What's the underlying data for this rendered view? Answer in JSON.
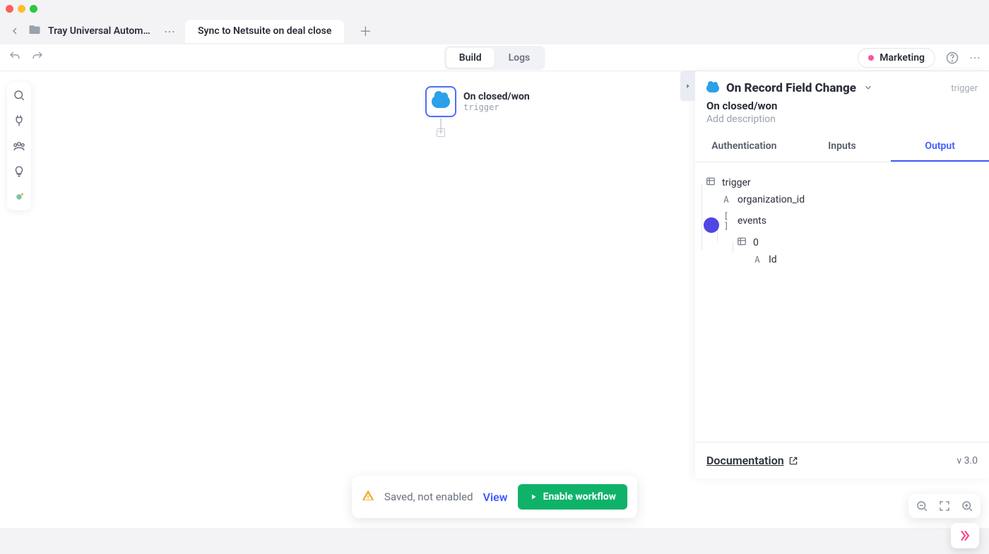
{
  "window": {
    "project_name": "Tray Universal Automatic",
    "active_tab": "Sync to Netsuite on deal close"
  },
  "toolbar": {
    "seg_build": "Build",
    "seg_logs": "Logs",
    "environment": "Marketing"
  },
  "canvas_node": {
    "title": "On closed/won",
    "subtitle": "trigger"
  },
  "right_panel": {
    "header_title": "On Record Field Change",
    "type_label": "trigger",
    "node_name": "On closed/won",
    "desc_placeholder": "Add description",
    "tabs": {
      "auth": "Authentication",
      "inputs": "Inputs",
      "output": "Output"
    },
    "tree": {
      "root": "trigger",
      "org": "organization_id",
      "events": "events",
      "idx0": "0",
      "id": "Id"
    },
    "doc_link": "Documentation",
    "version": "v 3.0"
  },
  "status": {
    "text": "Saved, not enabled",
    "view": "View",
    "enable": "Enable workflow"
  }
}
